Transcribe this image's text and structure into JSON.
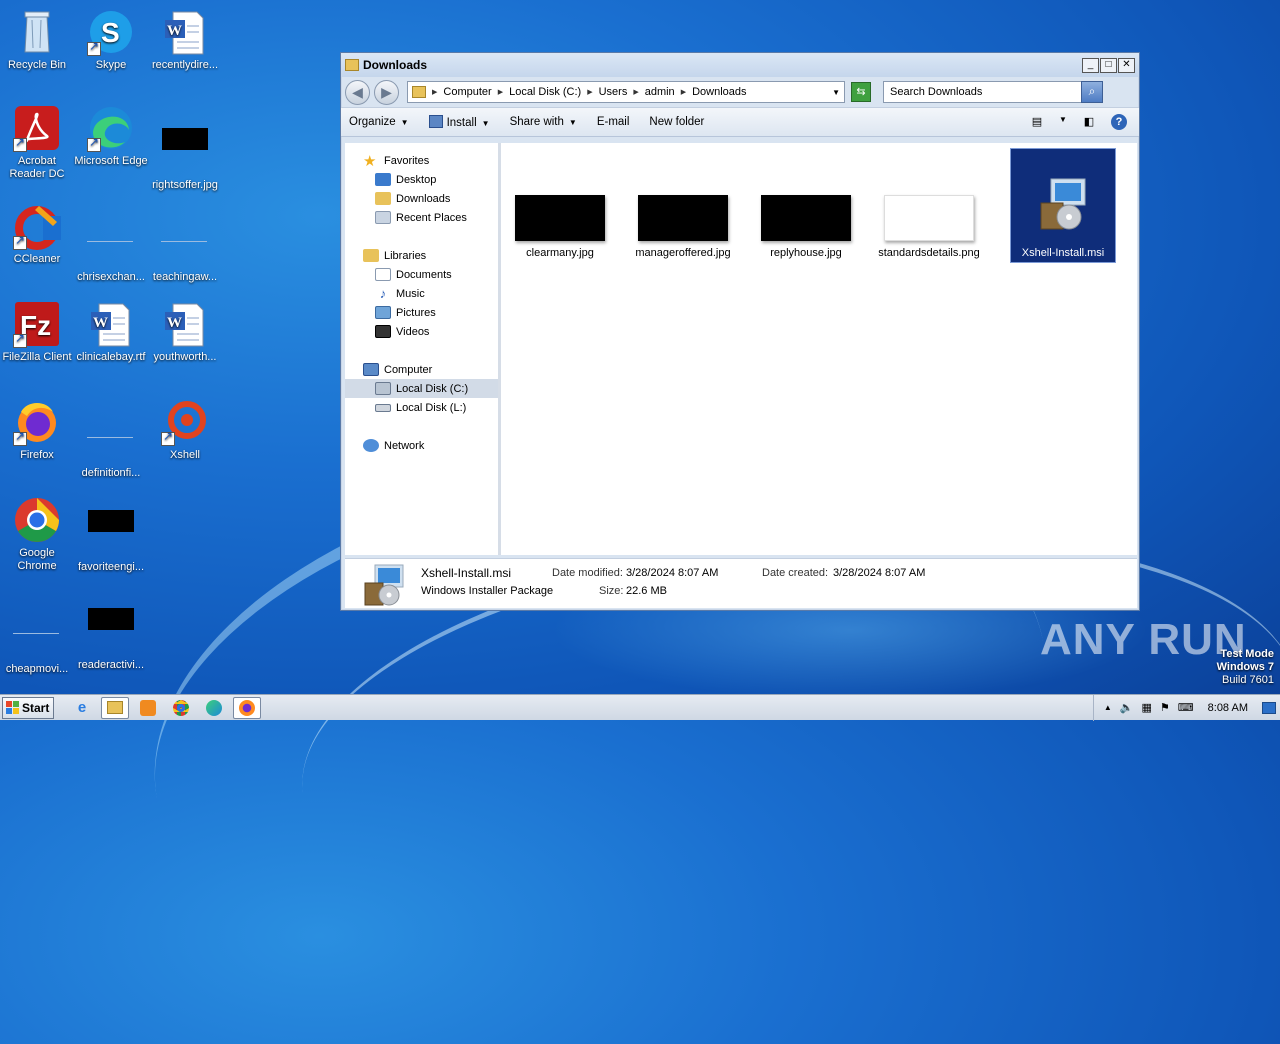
{
  "desktop": {
    "icons": [
      {
        "label": "Recycle Bin"
      },
      {
        "label": "Skype"
      },
      {
        "label": "recentlydire..."
      },
      {
        "label": "Acrobat Reader DC"
      },
      {
        "label": "Microsoft Edge"
      },
      {
        "label": "rightsoffer.jpg"
      },
      {
        "label": "CCleaner"
      },
      {
        "label": "chrisexchan..."
      },
      {
        "label": "teachingaw..."
      },
      {
        "label": "FileZilla Client"
      },
      {
        "label": "clinicalebay.rtf"
      },
      {
        "label": "youthworth..."
      },
      {
        "label": "Firefox"
      },
      {
        "label": "definitionfi..."
      },
      {
        "label": "Xshell"
      },
      {
        "label": "Google Chrome"
      },
      {
        "label": "favoriteengi..."
      },
      {
        "label": "cheapmovi..."
      },
      {
        "label": "readeractivi..."
      }
    ]
  },
  "window": {
    "title": "Downloads",
    "address": {
      "parts": [
        "Computer",
        "Local Disk (C:)",
        "Users",
        "admin",
        "Downloads"
      ]
    },
    "search_placeholder": "Search Downloads",
    "toolbar": {
      "organize": "Organize",
      "install": "Install",
      "share_with": "Share with",
      "email": "E-mail",
      "new_folder": "New folder"
    },
    "nav": {
      "favorites": "Favorites",
      "desktop": "Desktop",
      "downloads": "Downloads",
      "recent_places": "Recent Places",
      "libraries": "Libraries",
      "documents": "Documents",
      "music": "Music",
      "pictures": "Pictures",
      "videos": "Videos",
      "computer": "Computer",
      "local_disk_c": "Local Disk (C:)",
      "local_disk_l": "Local Disk (L:)",
      "network": "Network"
    },
    "files": [
      {
        "name": "clearmany.jpg"
      },
      {
        "name": "manageroffered.jpg"
      },
      {
        "name": "replyhouse.jpg"
      },
      {
        "name": "standardsdetails.png"
      },
      {
        "name": "Xshell-Install.msi"
      }
    ],
    "details": {
      "name": "Xshell-Install.msi",
      "type": "Windows Installer Package",
      "date_modified_label": "Date modified:",
      "date_modified": "3/28/2024 8:07 AM",
      "date_created_label": "Date created:",
      "date_created": "3/28/2024 8:07 AM",
      "size_label": "Size:",
      "size": "22.6 MB"
    }
  },
  "watermark": {
    "text": "ANY RUN",
    "test_mode": "Test Mode",
    "os": "Windows 7",
    "build": "Build 7601"
  },
  "taskbar": {
    "start": "Start",
    "clock": "8:08 AM"
  }
}
